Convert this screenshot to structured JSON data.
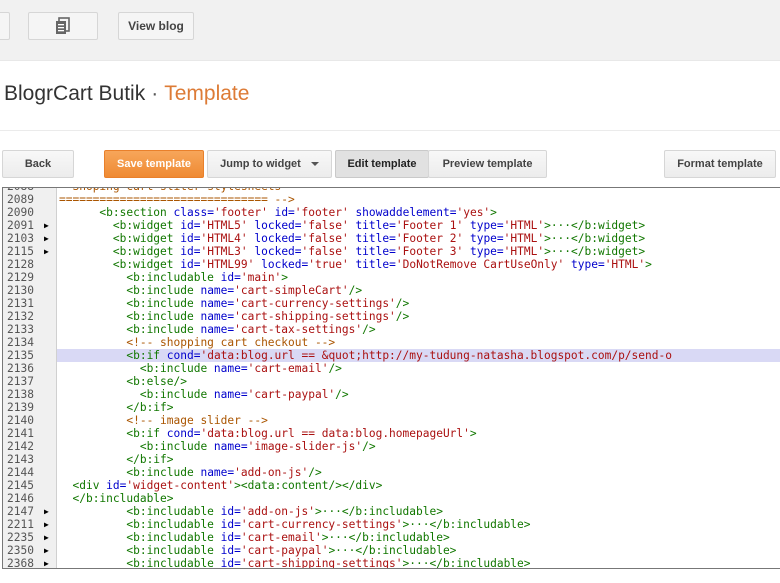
{
  "top": {
    "icon_button": "pages-icon",
    "view_blog": "View blog"
  },
  "header": {
    "blog_name": "BlogrCart Butik",
    "separator": "·",
    "section": "Template"
  },
  "toolbar": {
    "back": "Back",
    "save": "Save template",
    "jump": "Jump to widget",
    "edit": "Edit template",
    "preview": "Preview template",
    "format": "Format template"
  },
  "colors": {
    "accent": "#dd7b36",
    "save_button": "#ef8a33",
    "highlight_line": "#d9d9f5",
    "tag": "#117700",
    "attr": "#0000cc",
    "string": "#aa1111",
    "comment": "#aa5500"
  },
  "editor": {
    "lines": [
      {
        "num": "2088",
        "fold": "",
        "hl": false,
        "segs": [
          {
            "k": "p",
            "t": "  "
          },
          {
            "k": "c",
            "t": "Shoping cart sliter stylesheets"
          }
        ]
      },
      {
        "num": "2089",
        "fold": "",
        "hl": false,
        "segs": [
          {
            "k": "c",
            "t": "=============================== -->"
          }
        ]
      },
      {
        "num": "2090",
        "fold": "",
        "hl": false,
        "segs": [
          {
            "k": "p",
            "t": "      "
          },
          {
            "k": "t",
            "t": "<b:section "
          },
          {
            "k": "a",
            "t": "class="
          },
          {
            "k": "v",
            "t": "'footer'"
          },
          {
            "k": "t",
            "t": " "
          },
          {
            "k": "a",
            "t": "id="
          },
          {
            "k": "v",
            "t": "'footer'"
          },
          {
            "k": "t",
            "t": " "
          },
          {
            "k": "a",
            "t": "showaddelement="
          },
          {
            "k": "v",
            "t": "'yes'"
          },
          {
            "k": "t",
            "t": ">"
          }
        ]
      },
      {
        "num": "2091",
        "fold": "▶",
        "hl": false,
        "segs": [
          {
            "k": "p",
            "t": "        "
          },
          {
            "k": "t",
            "t": "<b:widget "
          },
          {
            "k": "a",
            "t": "id="
          },
          {
            "k": "v",
            "t": "'HTML5'"
          },
          {
            "k": "t",
            "t": " "
          },
          {
            "k": "a",
            "t": "locked="
          },
          {
            "k": "v",
            "t": "'false'"
          },
          {
            "k": "t",
            "t": " "
          },
          {
            "k": "a",
            "t": "title="
          },
          {
            "k": "v",
            "t": "'Footer 1'"
          },
          {
            "k": "t",
            "t": " "
          },
          {
            "k": "a",
            "t": "type="
          },
          {
            "k": "v",
            "t": "'HTML'"
          },
          {
            "k": "t",
            "t": ">···</b:widget>"
          }
        ]
      },
      {
        "num": "2103",
        "fold": "▶",
        "hl": false,
        "segs": [
          {
            "k": "p",
            "t": "        "
          },
          {
            "k": "t",
            "t": "<b:widget "
          },
          {
            "k": "a",
            "t": "id="
          },
          {
            "k": "v",
            "t": "'HTML4'"
          },
          {
            "k": "t",
            "t": " "
          },
          {
            "k": "a",
            "t": "locked="
          },
          {
            "k": "v",
            "t": "'false'"
          },
          {
            "k": "t",
            "t": " "
          },
          {
            "k": "a",
            "t": "title="
          },
          {
            "k": "v",
            "t": "'Footer 2'"
          },
          {
            "k": "t",
            "t": " "
          },
          {
            "k": "a",
            "t": "type="
          },
          {
            "k": "v",
            "t": "'HTML'"
          },
          {
            "k": "t",
            "t": ">···</b:widget>"
          }
        ]
      },
      {
        "num": "2115",
        "fold": "▶",
        "hl": false,
        "segs": [
          {
            "k": "p",
            "t": "        "
          },
          {
            "k": "t",
            "t": "<b:widget "
          },
          {
            "k": "a",
            "t": "id="
          },
          {
            "k": "v",
            "t": "'HTML3'"
          },
          {
            "k": "t",
            "t": " "
          },
          {
            "k": "a",
            "t": "locked="
          },
          {
            "k": "v",
            "t": "'false'"
          },
          {
            "k": "t",
            "t": " "
          },
          {
            "k": "a",
            "t": "title="
          },
          {
            "k": "v",
            "t": "'Footer 3'"
          },
          {
            "k": "t",
            "t": " "
          },
          {
            "k": "a",
            "t": "type="
          },
          {
            "k": "v",
            "t": "'HTML'"
          },
          {
            "k": "t",
            "t": ">···</b:widget>"
          }
        ]
      },
      {
        "num": "2128",
        "fold": "",
        "hl": false,
        "segs": [
          {
            "k": "p",
            "t": "        "
          },
          {
            "k": "t",
            "t": "<b:widget "
          },
          {
            "k": "a",
            "t": "id="
          },
          {
            "k": "v",
            "t": "'HTML99'"
          },
          {
            "k": "t",
            "t": " "
          },
          {
            "k": "a",
            "t": "locked="
          },
          {
            "k": "v",
            "t": "'true'"
          },
          {
            "k": "t",
            "t": " "
          },
          {
            "k": "a",
            "t": "title="
          },
          {
            "k": "v",
            "t": "'DoNotRemove CartUseOnly'"
          },
          {
            "k": "t",
            "t": " "
          },
          {
            "k": "a",
            "t": "type="
          },
          {
            "k": "v",
            "t": "'HTML'"
          },
          {
            "k": "t",
            "t": ">"
          }
        ]
      },
      {
        "num": "2129",
        "fold": "",
        "hl": false,
        "segs": [
          {
            "k": "p",
            "t": "          "
          },
          {
            "k": "t",
            "t": "<b:includable "
          },
          {
            "k": "a",
            "t": "id="
          },
          {
            "k": "v",
            "t": "'main'"
          },
          {
            "k": "t",
            "t": ">"
          }
        ]
      },
      {
        "num": "2130",
        "fold": "",
        "hl": false,
        "segs": [
          {
            "k": "p",
            "t": "          "
          },
          {
            "k": "t",
            "t": "<b:include "
          },
          {
            "k": "a",
            "t": "name="
          },
          {
            "k": "v",
            "t": "'cart-simpleCart'"
          },
          {
            "k": "t",
            "t": "/>"
          }
        ]
      },
      {
        "num": "2131",
        "fold": "",
        "hl": false,
        "segs": [
          {
            "k": "p",
            "t": "          "
          },
          {
            "k": "t",
            "t": "<b:include "
          },
          {
            "k": "a",
            "t": "name="
          },
          {
            "k": "v",
            "t": "'cart-currency-settings'"
          },
          {
            "k": "t",
            "t": "/>"
          }
        ]
      },
      {
        "num": "2132",
        "fold": "",
        "hl": false,
        "segs": [
          {
            "k": "p",
            "t": "          "
          },
          {
            "k": "t",
            "t": "<b:include "
          },
          {
            "k": "a",
            "t": "name="
          },
          {
            "k": "v",
            "t": "'cart-shipping-settings'"
          },
          {
            "k": "t",
            "t": "/>"
          }
        ]
      },
      {
        "num": "2133",
        "fold": "",
        "hl": false,
        "segs": [
          {
            "k": "p",
            "t": "          "
          },
          {
            "k": "t",
            "t": "<b:include "
          },
          {
            "k": "a",
            "t": "name="
          },
          {
            "k": "v",
            "t": "'cart-tax-settings'"
          },
          {
            "k": "t",
            "t": "/>"
          }
        ]
      },
      {
        "num": "2134",
        "fold": "",
        "hl": false,
        "segs": [
          {
            "k": "p",
            "t": "          "
          },
          {
            "k": "c",
            "t": "<!-- shopping cart checkout -->"
          }
        ]
      },
      {
        "num": "2135",
        "fold": "",
        "hl": true,
        "segs": [
          {
            "k": "p",
            "t": "          "
          },
          {
            "k": "t",
            "t": "<b:if "
          },
          {
            "k": "a",
            "t": "cond="
          },
          {
            "k": "v",
            "t": "'data:blog.url == &quot;http://my-tudung-natasha.blogspot.com/p/send-o"
          }
        ]
      },
      {
        "num": "2136",
        "fold": "",
        "hl": false,
        "segs": [
          {
            "k": "p",
            "t": "            "
          },
          {
            "k": "t",
            "t": "<b:include "
          },
          {
            "k": "a",
            "t": "name="
          },
          {
            "k": "v",
            "t": "'cart-email'"
          },
          {
            "k": "t",
            "t": "/>"
          }
        ]
      },
      {
        "num": "2137",
        "fold": "",
        "hl": false,
        "segs": [
          {
            "k": "p",
            "t": "          "
          },
          {
            "k": "t",
            "t": "<b:else/>"
          }
        ]
      },
      {
        "num": "2138",
        "fold": "",
        "hl": false,
        "segs": [
          {
            "k": "p",
            "t": "            "
          },
          {
            "k": "t",
            "t": "<b:include "
          },
          {
            "k": "a",
            "t": "name="
          },
          {
            "k": "v",
            "t": "'cart-paypal'"
          },
          {
            "k": "t",
            "t": "/>"
          }
        ]
      },
      {
        "num": "2139",
        "fold": "",
        "hl": false,
        "segs": [
          {
            "k": "p",
            "t": "          "
          },
          {
            "k": "t",
            "t": "</b:if>"
          }
        ]
      },
      {
        "num": "2140",
        "fold": "",
        "hl": false,
        "segs": [
          {
            "k": "p",
            "t": "          "
          },
          {
            "k": "c",
            "t": "<!-- image slider -->"
          }
        ]
      },
      {
        "num": "2141",
        "fold": "",
        "hl": false,
        "segs": [
          {
            "k": "p",
            "t": "          "
          },
          {
            "k": "t",
            "t": "<b:if "
          },
          {
            "k": "a",
            "t": "cond="
          },
          {
            "k": "v",
            "t": "'data:blog.url == data:blog.homepageUrl'"
          },
          {
            "k": "t",
            "t": ">"
          }
        ]
      },
      {
        "num": "2142",
        "fold": "",
        "hl": false,
        "segs": [
          {
            "k": "p",
            "t": "            "
          },
          {
            "k": "t",
            "t": "<b:include "
          },
          {
            "k": "a",
            "t": "name="
          },
          {
            "k": "v",
            "t": "'image-slider-js'"
          },
          {
            "k": "t",
            "t": "/>"
          }
        ]
      },
      {
        "num": "2143",
        "fold": "",
        "hl": false,
        "segs": [
          {
            "k": "p",
            "t": "          "
          },
          {
            "k": "t",
            "t": "</b:if>"
          }
        ]
      },
      {
        "num": "2144",
        "fold": "",
        "hl": false,
        "segs": [
          {
            "k": "p",
            "t": "          "
          },
          {
            "k": "t",
            "t": "<b:include "
          },
          {
            "k": "a",
            "t": "name="
          },
          {
            "k": "v",
            "t": "'add-on-js'"
          },
          {
            "k": "t",
            "t": "/>"
          }
        ]
      },
      {
        "num": "2145",
        "fold": "",
        "hl": false,
        "segs": [
          {
            "k": "p",
            "t": "  "
          },
          {
            "k": "t",
            "t": "<div "
          },
          {
            "k": "a",
            "t": "id="
          },
          {
            "k": "v",
            "t": "'widget-content'"
          },
          {
            "k": "t",
            "t": "><data:content/></div>"
          }
        ]
      },
      {
        "num": "2146",
        "fold": "",
        "hl": false,
        "segs": [
          {
            "k": "p",
            "t": "  "
          },
          {
            "k": "t",
            "t": "</b:includable>"
          }
        ]
      },
      {
        "num": "2147",
        "fold": "▶",
        "hl": false,
        "segs": [
          {
            "k": "p",
            "t": "          "
          },
          {
            "k": "t",
            "t": "<b:includable "
          },
          {
            "k": "a",
            "t": "id="
          },
          {
            "k": "v",
            "t": "'add-on-js'"
          },
          {
            "k": "t",
            "t": ">···</b:includable>"
          }
        ]
      },
      {
        "num": "2211",
        "fold": "▶",
        "hl": false,
        "segs": [
          {
            "k": "p",
            "t": "          "
          },
          {
            "k": "t",
            "t": "<b:includable "
          },
          {
            "k": "a",
            "t": "id="
          },
          {
            "k": "v",
            "t": "'cart-currency-settings'"
          },
          {
            "k": "t",
            "t": ">···</b:includable>"
          }
        ]
      },
      {
        "num": "2235",
        "fold": "▶",
        "hl": false,
        "segs": [
          {
            "k": "p",
            "t": "          "
          },
          {
            "k": "t",
            "t": "<b:includable "
          },
          {
            "k": "a",
            "t": "id="
          },
          {
            "k": "v",
            "t": "'cart-email'"
          },
          {
            "k": "t",
            "t": ">···</b:includable>"
          }
        ]
      },
      {
        "num": "2350",
        "fold": "▶",
        "hl": false,
        "segs": [
          {
            "k": "p",
            "t": "          "
          },
          {
            "k": "t",
            "t": "<b:includable "
          },
          {
            "k": "a",
            "t": "id="
          },
          {
            "k": "v",
            "t": "'cart-paypal'"
          },
          {
            "k": "t",
            "t": ">···</b:includable>"
          }
        ]
      },
      {
        "num": "2368",
        "fold": "▶",
        "hl": false,
        "segs": [
          {
            "k": "p",
            "t": "          "
          },
          {
            "k": "t",
            "t": "<b:includable "
          },
          {
            "k": "a",
            "t": "id="
          },
          {
            "k": "v",
            "t": "'cart-shipping-settings'"
          },
          {
            "k": "t",
            "t": ">···</b:includable>"
          }
        ]
      }
    ]
  }
}
